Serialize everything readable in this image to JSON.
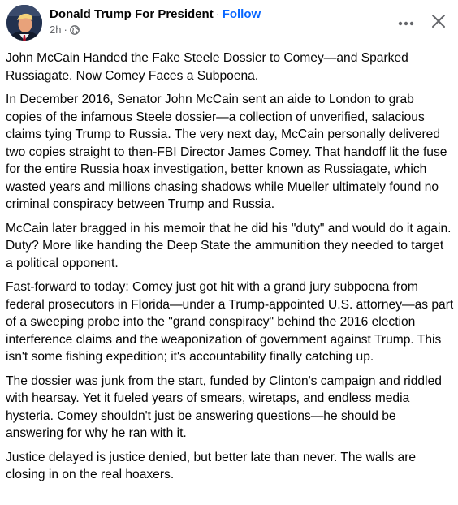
{
  "post": {
    "author": "Donald Trump For President",
    "separator": "·",
    "follow_label": "Follow",
    "time": "2h",
    "meta_separator": "·",
    "privacy_icon": "globe-icon",
    "more_icon": "more-horizontal-icon",
    "close_icon": "close-icon",
    "paragraphs": [
      "John McCain Handed the Fake Steele Dossier to Comey—and Sparked Russiagate. Now Comey Faces a Subpoena.",
      "In December 2016, Senator John McCain sent an aide to London to grab copies of the infamous Steele dossier—a collection of unverified, salacious claims tying Trump to Russia. The very next day, McCain personally delivered two copies straight to then-FBI Director James Comey. That handoff lit the fuse for the entire Russia hoax investigation, better known as Russiagate, which wasted years and millions chasing shadows while Mueller ultimately found no criminal conspiracy between Trump and Russia.",
      "McCain later bragged in his memoir that he did his \"duty\" and would do it again. Duty? More like handing the Deep State the ammunition they needed to target a political opponent.",
      "Fast-forward to today: Comey just got hit with a grand jury subpoena from federal prosecutors in Florida—under a Trump-appointed U.S. attorney—as part of a sweeping probe into the \"grand conspiracy\" behind the 2016 election interference claims and the weaponization of government against Trump. This isn't some fishing expedition; it's accountability finally catching up.",
      "The dossier was junk from the start, funded by Clinton's campaign and riddled with hearsay. Yet it fueled years of smears, wiretaps, and endless media hysteria. Comey shouldn't just be answering questions—he should be answering for why he ran with it.",
      "Justice delayed is justice denied, but better late than never. The walls are closing in on the real hoaxers."
    ]
  },
  "colors": {
    "text": "#050505",
    "secondary_text": "#65676b",
    "link_blue": "#0866ff"
  }
}
